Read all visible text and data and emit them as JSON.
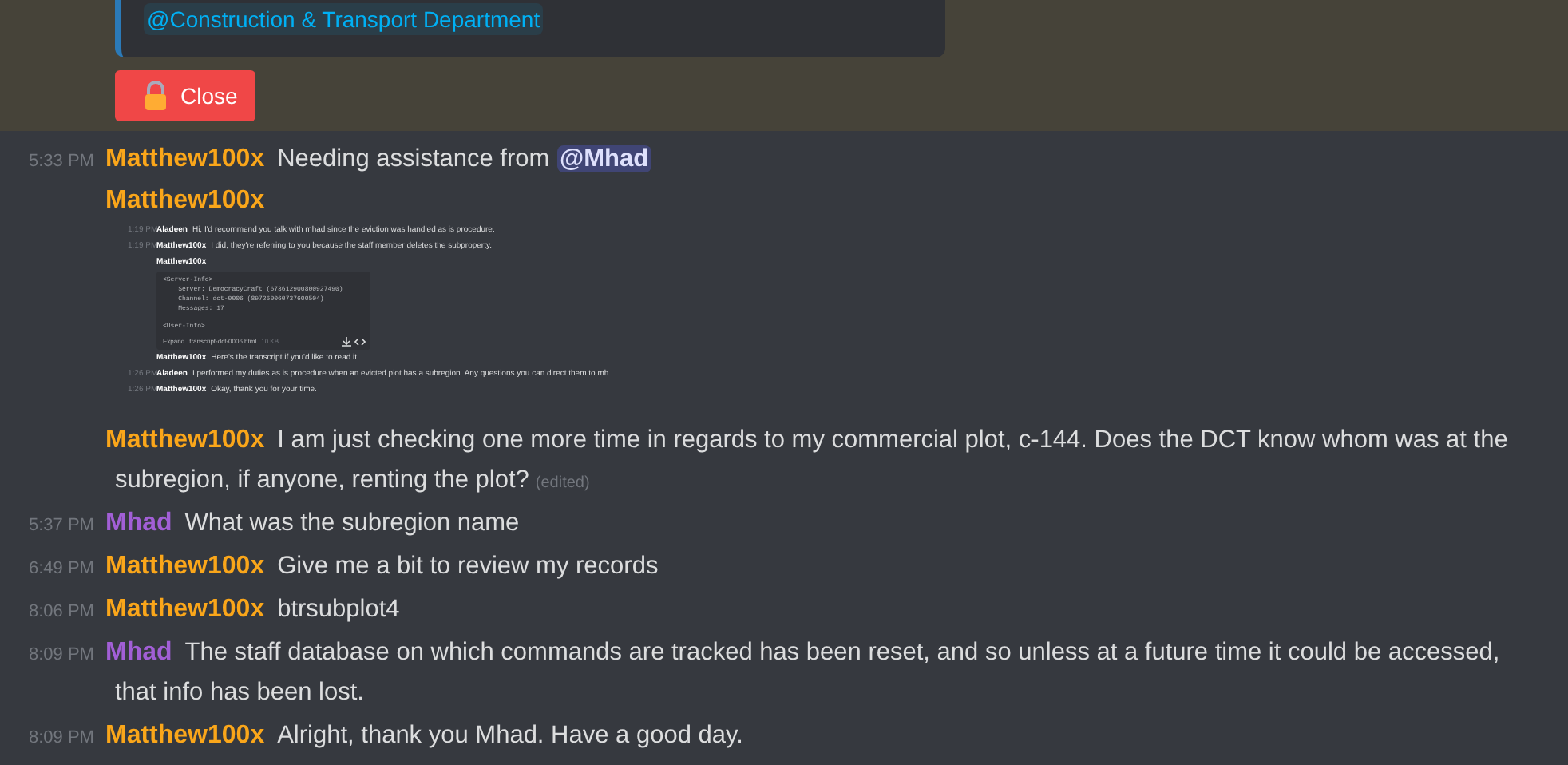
{
  "embed": {
    "mention": "@Construction & Transport Department"
  },
  "close_button": {
    "label": "Close"
  },
  "messages": [
    {
      "kind": "text",
      "time": "5:33 PM",
      "author": "Matthew100x",
      "color": "#faa61a",
      "text": "Needing assistance from",
      "mention": "@Mhad"
    },
    {
      "kind": "attachment",
      "author": "Matthew100x",
      "color": "#faa61a",
      "lines": [
        {
          "kind": "message",
          "time": "1:19 PM",
          "author": "Aladeen",
          "text": "Hi, I'd recommend you talk with mhad since the eviction was handled as is procedure."
        },
        {
          "kind": "message",
          "time": "1:19 PM",
          "author": "Matthew100x",
          "text": "I did, they're referring to you because the staff member deletes the subproperty."
        },
        {
          "kind": "header",
          "author": "Matthew100x"
        },
        {
          "kind": "file",
          "code": [
            "<Server-Info>",
            "    Server: DemocracyCraft (673612900800927490)",
            "    Channel: dct-0006 (897260060737600504)",
            "    Messages: 17",
            "<User-Info>"
          ],
          "expand": "Expand",
          "filename": "transcript-dct-0006.html",
          "size": "10 KB"
        },
        {
          "kind": "message",
          "author": "Matthew100x",
          "text": "Here's the transcript if you'd like to read it"
        },
        {
          "kind": "message",
          "time": "1:26 PM",
          "author": "Aladeen",
          "text": "I performed my duties as is procedure when an evicted plot has a subregion. Any questions you can direct them to mh"
        },
        {
          "kind": "message",
          "time": "1:26 PM",
          "author": "Matthew100x",
          "text": "Okay, thank you for your time."
        }
      ]
    },
    {
      "kind": "text",
      "author": "Matthew100x",
      "color": "#faa61a",
      "text": "I am just checking one more time in regards to my commercial plot, c-144. Does the DCT know whom was at the subregion, if anyone, renting the plot?",
      "edited": "(edited)"
    },
    {
      "kind": "text",
      "time": "5:37 PM",
      "author": "Mhad",
      "color": "#a25fd6",
      "text": "What was the subregion name"
    },
    {
      "kind": "text",
      "time": "6:49 PM",
      "author": "Matthew100x",
      "color": "#faa61a",
      "text": "Give me a bit to review my records"
    },
    {
      "kind": "text",
      "time": "8:06 PM",
      "author": "Matthew100x",
      "color": "#faa61a",
      "text": "btrsubplot4"
    },
    {
      "kind": "text",
      "time": "8:09 PM",
      "author": "Mhad",
      "color": "#a25fd6",
      "text": "The staff database on which commands are tracked has been reset, and so unless at a future time it could be accessed, that info has been lost."
    },
    {
      "kind": "text",
      "time": "8:09 PM",
      "author": "Matthew100x",
      "color": "#faa61a",
      "text": "Alright, thank you Mhad. Have a good day."
    }
  ]
}
